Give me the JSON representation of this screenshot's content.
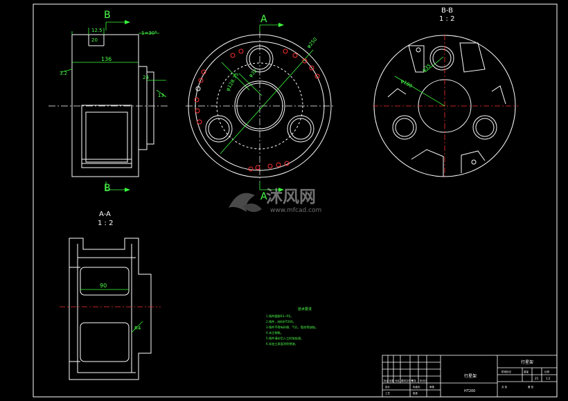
{
  "view_labels": {
    "section_b_top": "B",
    "section_b_bottom": "B",
    "section_a_top": "A",
    "section_a_bottom": "A",
    "bb_title": "B-B",
    "bb_scale": "1 : 2",
    "aa_title": "A-A",
    "aa_scale": "1 : 2"
  },
  "dimensions": {
    "side_136": "136",
    "side_20": "20",
    "side_12": "12.5",
    "side_24": "24",
    "side_chamfer": "1×30°",
    "side_13": "13",
    "side_left": "3.2",
    "front_dia": "φ250",
    "front_pcd": "φ128.75",
    "front_small": "φ32",
    "bb_dia": "φ180",
    "bb_hole": "φ35",
    "aa_90": "90",
    "aa_r": "R4"
  },
  "watermark": {
    "brand": "沐风网",
    "url": "www.mfcad.com"
  },
  "tech_notes": {
    "title": "技术要求",
    "lines": [
      "1.铸件圆角R3~R5。",
      "2.铸件，材料HT200。",
      "3.铸件不得有砂眼、气孔、裂纹等缺陷。",
      "4.未注倒角。",
      "5.铸件清砂后人工时效处理。",
      "6.非加工表面涂防锈漆。"
    ]
  },
  "title_block": {
    "part_name": "行星架",
    "material": "HT200",
    "drawing_no": "行星架",
    "cells": [
      "标记",
      "处数",
      "分区",
      "更改文件号",
      "签名",
      "年月日",
      "设计",
      "标准化",
      "审核",
      "工艺",
      "批准",
      "阶段标记",
      "重量",
      "比例",
      "25",
      "1:2",
      "共 张",
      "第 张"
    ]
  }
}
